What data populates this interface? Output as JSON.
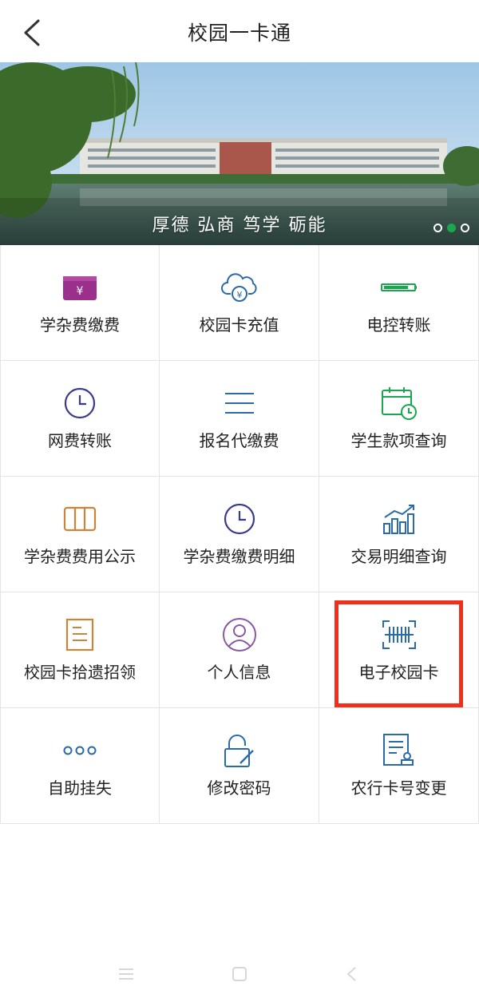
{
  "header": {
    "title": "校园一卡通",
    "back_icon": "chevron-left-icon"
  },
  "banner": {
    "caption": "厚德 弘商 笃学 砺能",
    "slide_count": 3,
    "active_slide": 2
  },
  "grid": {
    "items": [
      {
        "label": "学杂费缴费",
        "icon": "tuition-payment-card-icon"
      },
      {
        "label": "校园卡充值",
        "icon": "cloud-recharge-icon"
      },
      {
        "label": "电控转账",
        "icon": "battery-bar-icon"
      },
      {
        "label": "网费转账",
        "icon": "clock-icon"
      },
      {
        "label": "报名代缴费",
        "icon": "list-lines-icon"
      },
      {
        "label": "学生款项查询",
        "icon": "calendar-clock-icon"
      },
      {
        "label": "学杂费费用公示",
        "icon": "columns-board-icon"
      },
      {
        "label": "学杂费缴费明细",
        "icon": "clock-icon"
      },
      {
        "label": "交易明细查询",
        "icon": "bar-chart-trend-icon"
      },
      {
        "label": "校园卡拾遗招领",
        "icon": "document-icon"
      },
      {
        "label": "个人信息",
        "icon": "user-profile-icon"
      },
      {
        "label": "电子校园卡",
        "icon": "barcode-scan-icon"
      },
      {
        "label": "自助挂失",
        "icon": "more-dots-icon"
      },
      {
        "label": "修改密码",
        "icon": "lock-edit-icon"
      },
      {
        "label": "农行卡号变更",
        "icon": "document-stamp-icon"
      }
    ]
  },
  "highlight": {
    "target": "电子校园卡",
    "color": "#f0301c"
  },
  "navbar": {
    "menu_icon": "menu-icon",
    "home_icon": "home-square-icon",
    "back_icon": "back-triangle-icon"
  },
  "colors": {
    "accent_green": "#19a84f",
    "icon_purple": "#9a2f8c",
    "icon_blue": "#2b6aa8",
    "icon_orange": "#c8863a"
  }
}
